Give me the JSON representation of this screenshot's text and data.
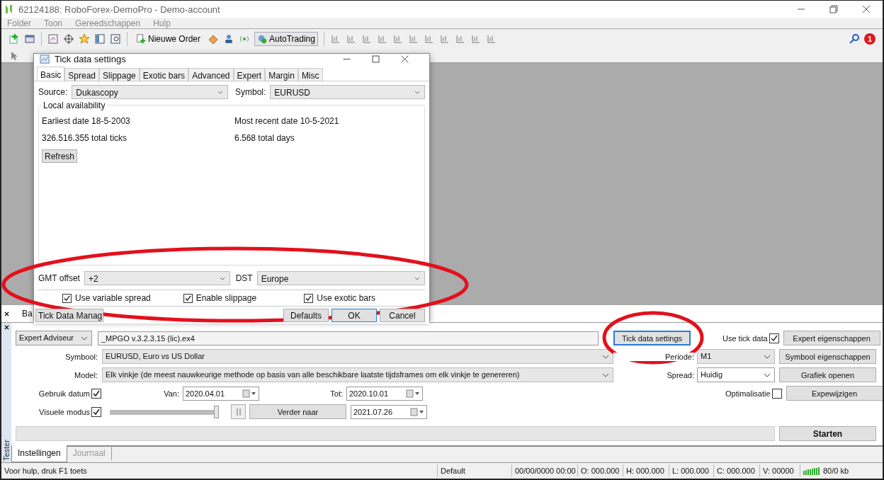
{
  "window": {
    "title": "62124188: RoboForex-DemoPro - Demo-account"
  },
  "menu": [
    "Folder",
    "Toon",
    "Gereedschappen",
    "Hulp"
  ],
  "toolbar": {
    "new_order": "Nieuwe Order",
    "autotrading": "AutoTrading",
    "notifications": "1"
  },
  "dialog": {
    "title": "Tick data settings",
    "tabs": [
      {
        "label": "Basic",
        "selected": true
      },
      {
        "label": "Spread",
        "selected": false
      },
      {
        "label": "Slippage",
        "selected": false
      },
      {
        "label": "Exotic bars",
        "selected": false
      },
      {
        "label": "Advanced",
        "selected": false
      },
      {
        "label": "Expert",
        "selected": false
      },
      {
        "label": "Margin",
        "selected": false
      },
      {
        "label": "Misc",
        "selected": false
      }
    ],
    "source": {
      "label": "Source:",
      "value": "Dukascopy"
    },
    "symbol": {
      "label": "Symbol:",
      "value": "EURUSD"
    },
    "availability": {
      "title": "Local availability",
      "earliest": "Earliest date 18-5-2003",
      "most_recent": "Most recent date 10-5-2021",
      "ticks": "326.516.355 total ticks",
      "days": "6.568 total days",
      "refresh": "Refresh"
    },
    "gmt_offset": {
      "label": "GMT offset",
      "value": "+2"
    },
    "dst": {
      "label": "DST",
      "value": "Europe"
    },
    "checkboxes": [
      {
        "label": "Use variable spread",
        "checked": true
      },
      {
        "label": "Enable slippage",
        "checked": true
      },
      {
        "label": "Use exotic bars",
        "checked": true
      }
    ],
    "manager_button": "Tick Data Manag",
    "buttons": [
      "Defaults",
      "OK",
      "Cancel"
    ]
  },
  "panel_tab": "Ba",
  "tester": {
    "side_label": "Tester",
    "expert_type": "Expert Adviseur",
    "expert_file": "_MPGO v.3.2.3.15 (lic).ex4",
    "tick_data_button": "Tick data settings",
    "use_tick_data": {
      "label": "Use tick data",
      "checked": true
    },
    "symbol": {
      "label": "Symbool:",
      "value": "EURUSD, Euro vs US Dollar"
    },
    "period": {
      "label": "Periode:",
      "value": "M1"
    },
    "model": {
      "label": "Model:",
      "value": "Elk vinkje (de meest nauwkeurige methode op basis van alle beschikbare laatste tijdsframes om elk vinkje te genereren)"
    },
    "spread": {
      "label": "Spread:",
      "value": "Huidig"
    },
    "use_date": {
      "label": "Gebruik datum",
      "checked": true
    },
    "from": {
      "label": "Van:",
      "value": "2020.04.01"
    },
    "to": {
      "label": "Tot:",
      "value": "2020.10.01"
    },
    "optimization": {
      "label": "Optimalisatie",
      "checked": false
    },
    "visual_mode": {
      "label": "Visuele modus",
      "checked": true
    },
    "speed": {
      "level": 1
    },
    "skip_button": "Verder naar",
    "skip_date": "2021.07.26",
    "side_buttons": [
      "Expert eigenschappen",
      "Symbool eigenschappen",
      "Grafiek openen",
      "Expewijzigen"
    ],
    "progress": {
      "level": 0
    },
    "start_button": "Starten",
    "tabs": [
      {
        "label": "Instellingen",
        "selected": true
      },
      {
        "label": "Journaal",
        "selected": false
      }
    ]
  },
  "status_bar": [
    "Voor hulp, druk F1 toets",
    "Default",
    "00/00/0000 00:00",
    "O: 000.000",
    "H: 000.000",
    "L: 000.000",
    "C: 000.000",
    "V: 00000",
    "80/0 kb"
  ]
}
